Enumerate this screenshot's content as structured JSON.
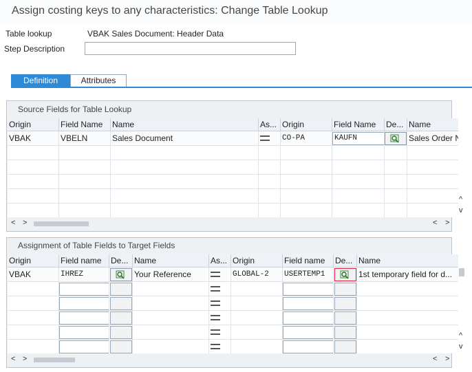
{
  "window": {
    "title": "Assign costing keys to any characteristics: Change Table Lookup"
  },
  "header": {
    "table_lookup_label": "Table lookup",
    "table_lookup_value": "VBAK Sales Document: Header Data",
    "step_description_label": "Step Description",
    "step_description_value": ""
  },
  "tabs": [
    {
      "label": "Definition",
      "active": true
    },
    {
      "label": "Attributes",
      "active": false
    }
  ],
  "source_panel": {
    "title": "Source Fields for Table Lookup",
    "columns": [
      "Origin",
      "Field Name",
      "Name",
      "As...",
      "Origin",
      "Field Name",
      "De...",
      "Name"
    ],
    "rows": [
      {
        "origin": "VBAK",
        "field_name": "VBELN",
        "name": "Sales Document",
        "assign": "=",
        "target_origin": "CO-PA",
        "target_field": "KAUFN",
        "target_name": "Sales Order Number"
      }
    ]
  },
  "assign_panel": {
    "title": "Assignment of Table Fields to Target Fields",
    "columns": [
      "Origin",
      "Field name",
      "De...",
      "Name",
      "As...",
      "Origin",
      "Field name",
      "De...",
      "Name"
    ],
    "rows": [
      {
        "origin": "VBAK",
        "field_name": "IHREZ",
        "name": "Your Reference",
        "assign": "=",
        "target_origin": "GLOBAL-2",
        "target_field": "USERTEMP1",
        "target_name": "1st temporary field for d..."
      }
    ]
  },
  "icons": {
    "details": "details-magnifier-icon",
    "equals": "equals-icon",
    "scroll_left": "◄",
    "scroll_right": "►"
  },
  "scroll": {
    "left": "<",
    "right": ">",
    "up": "^",
    "down": "v"
  },
  "colors": {
    "accent": "#2e8ad7",
    "panel_bg": "#eef1f4",
    "selected_border": "#e0203a"
  }
}
